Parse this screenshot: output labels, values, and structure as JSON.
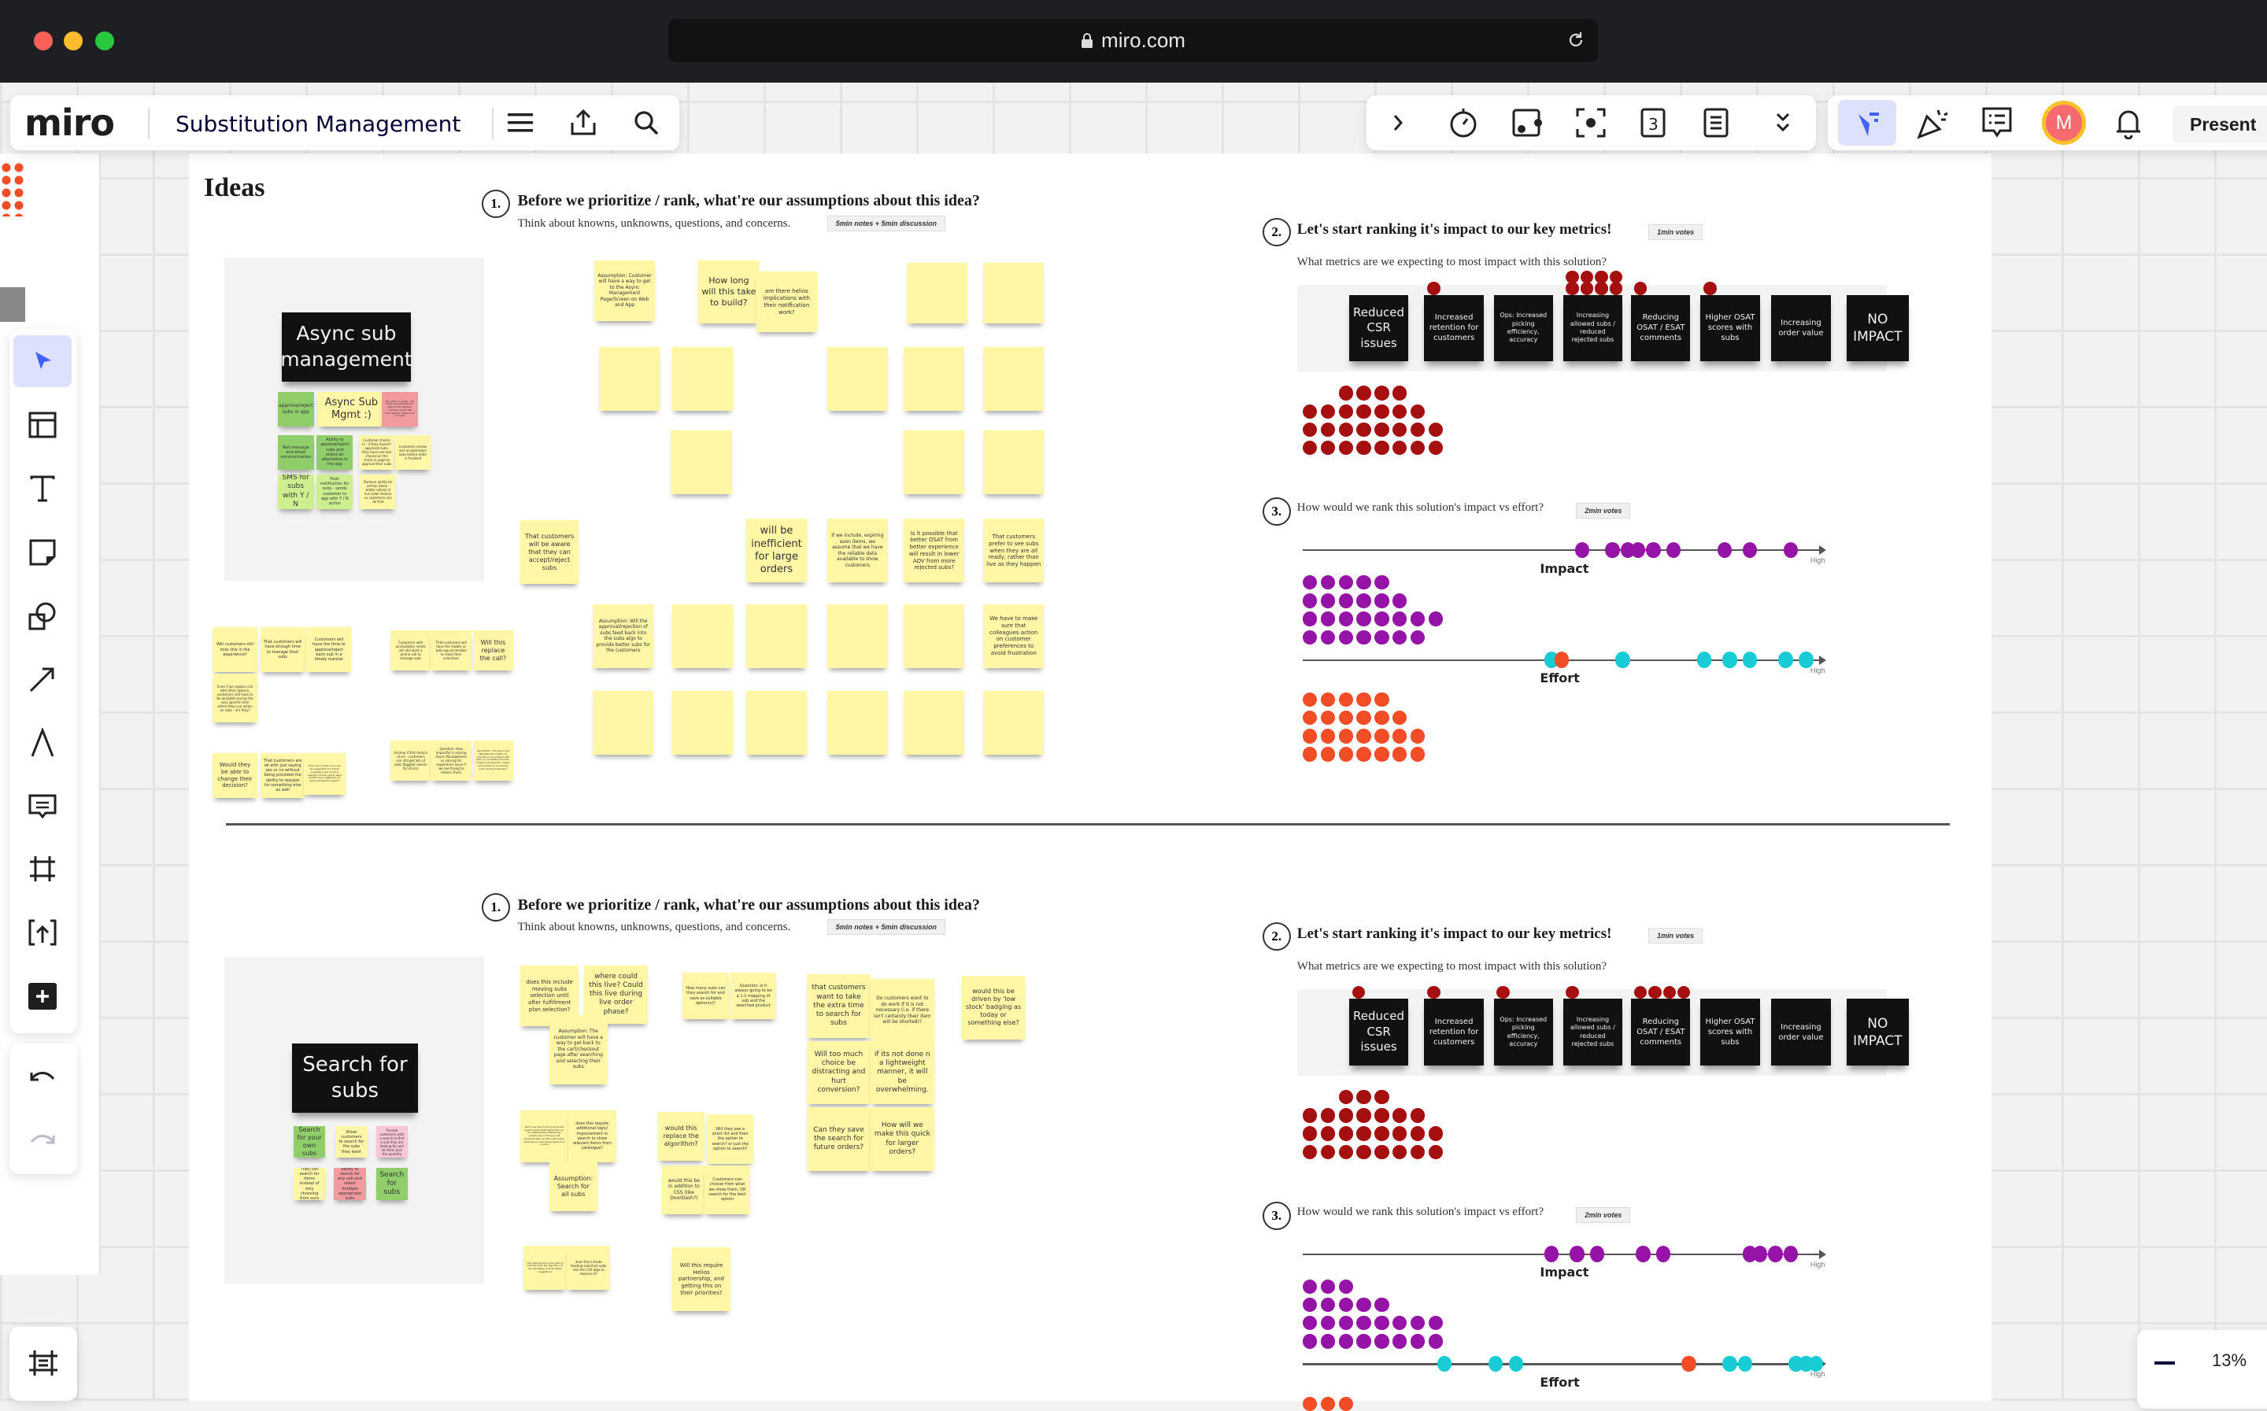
{
  "browser": {
    "url": "miro.com"
  },
  "header": {
    "logo": "miro",
    "board_title": "Substitution Management"
  },
  "toolbar_right": {
    "present_label": "Present",
    "avatar_initial": "M"
  },
  "zoom": {
    "level": "13%"
  },
  "board": {
    "title": "Ideas"
  },
  "colors": {
    "metric_vote": "#a50f0f",
    "impact_vote": "#9613a8",
    "effort_vote": "#19cbd4",
    "effort_vote_alt": "#f24d26",
    "note_yellow": "#fff6a6",
    "note_green": "#8fce6b",
    "note_light_green": "#cdef90",
    "note_pink": "#f19aa0",
    "note_light_pink": "#f8c6d6",
    "accent": "#4262ff"
  },
  "sections": [
    {
      "idea_title": "Async sub management",
      "step1": {
        "number": "1.",
        "title": "Before we prioritize / rank, what're our assumptions about this idea?",
        "subtitle": "Think about knowns, unknowns, questions,  and concerns.",
        "timer": "5min notes + 5min discussion"
      },
      "idea_notes": [
        {
          "text": "approve/reject subs in app",
          "color": "green"
        },
        {
          "text": "Async Sub Mgmt :)",
          "color": "yellow"
        },
        {
          "text": "Allocation in reality - are there any substitutions without the needing customer input? We don't want to make it too complex",
          "color": "pink"
        },
        {
          "text": "Text message and email communication",
          "color": "green"
        },
        {
          "text": "Ability to approve/reject subs and select an alternative in the app",
          "color": "green"
        },
        {
          "text": "Customer checks in - if they haven't approved subs, they have one last chance on the check in page to approve their subs",
          "color": "yellow"
        },
        {
          "text": "customers review and accept/reject subs before order is finalized",
          "color": "yellow"
        },
        {
          "text": "SMS for subs with Y / N",
          "color": "light_green"
        },
        {
          "text": "Push notification for subs - sends customer to app with Y / N action",
          "color": "light_green"
        },
        {
          "text": "Remove ability for ad-hoc items - better rollout of live order feature so customers can do that",
          "color": "yellow"
        }
      ],
      "assumption_notes": [
        {
          "text": "Assumption: Customer will have a way to get to the Async Management Page/Screen on Web and App"
        },
        {
          "text": "How long will this take to build?"
        },
        {
          "text": "are there helios implications with their notification work?"
        },
        {
          "text": ""
        },
        {
          "text": ""
        },
        {
          "text": ""
        },
        {
          "text": ""
        },
        {
          "text": ""
        },
        {
          "text": ""
        },
        {
          "text": ""
        },
        {
          "text": ""
        },
        {
          "text": ""
        },
        {
          "text": ""
        },
        {
          "text": "That customers will be aware that they can accept/reject subs"
        },
        {
          "text": "will be inefficient for large orders"
        },
        {
          "text": "If we include, expiring soon items, we assume that we have the reliable data available to show customers"
        },
        {
          "text": "Is it possible that better OSAT from better experience will result in lower AOV from more rejected subs?"
        },
        {
          "text": "That customers prefer to see subs when they are all ready, rather than live as they happen"
        },
        {
          "text": "Assumption: Will the approval/rejection of subs feed back into the subs algo to provide better subs for the customers"
        },
        {
          "text": ""
        },
        {
          "text": ""
        },
        {
          "text": ""
        },
        {
          "text": ""
        },
        {
          "text": "We have to make sure that colleagues action on customer preferences to avoid frustration"
        },
        {
          "text": ""
        },
        {
          "text": ""
        },
        {
          "text": ""
        },
        {
          "text": ""
        },
        {
          "text": ""
        },
        {
          "text": ""
        },
        {
          "text": "Will customers still miss this in the experience?"
        },
        {
          "text": "That customers will have enough time to manage their subs"
        },
        {
          "text": "Customers will have the time to approve/reject each sub in a timely manner"
        },
        {
          "text": "Even if we replace call with other options, customers still have to be available during the very specific time where they can action on subs - are they?"
        },
        {
          "text": "Would they be able to change their decision?"
        },
        {
          "text": "That customers are ok with just saying yes or no without being provided the ability to request for something else as well"
        },
        {
          "text": "How many times can a sub be suggested? If a picker suggests a sub and it is rejected, do they get to send another sub suggestion for approval/rejection again?"
        },
        {
          "text": "Customers with accessibility needs will still want a phone call to manage subs"
        },
        {
          "text": "That customers will have the mobile or web app accessible to make their selections"
        },
        {
          "text": "Will this replace the call?"
        },
        {
          "text": "Unclear if this reduce churn - customers can still get lots of subs (biggest reason for churn)"
        },
        {
          "text": "Question: How impactful is solving Async Management vs solving for experience issue if we are trying to reduce churn"
        },
        {
          "text": "Assumption: The Async Sub Management might not solve the core problem with subs i.e. unrelated products, limited sub selection, higher priced subs or not having subs causing frustration"
        }
      ],
      "step2": {
        "number": "2.",
        "title": "Let's start ranking it's impact to our key metrics!",
        "timer": "1min votes",
        "subtitle": "What metrics are we expecting to most impact with this solution?"
      },
      "metrics": [
        {
          "label": "Reduced CSR issues",
          "votes": 0
        },
        {
          "label": "Increased retention for customers",
          "votes": 1
        },
        {
          "label": "Ops: Increased picking efficiency, accuracy",
          "votes": 0
        },
        {
          "label": "Increasing allowed subs / reduced rejected subs",
          "votes": 8
        },
        {
          "label": "Reducing OSAT / ESAT comments",
          "votes": 1
        },
        {
          "label": "Higher OSAT scores with subs",
          "votes": 1
        },
        {
          "label": "Increasing order value",
          "votes": 0
        },
        {
          "label": "NO IMPACT",
          "votes": 0
        }
      ],
      "unused_metric_vote_rows": [
        4,
        7,
        8,
        8
      ],
      "step3": {
        "number": "3.",
        "title": "How would we rank this solution's impact vs effort?",
        "timer": "2min votes",
        "impact_label": "Impact",
        "effort_label": "Effort",
        "high_label": "High"
      },
      "impact_votes": [
        54,
        60,
        63,
        65,
        68,
        72,
        82,
        87,
        95
      ],
      "effort_votes": [
        {
          "pos": 48,
          "color": "effort_vote"
        },
        {
          "pos": 50,
          "color": "effort_vote_alt"
        },
        {
          "pos": 62,
          "color": "effort_vote"
        },
        {
          "pos": 78,
          "color": "effort_vote"
        },
        {
          "pos": 83,
          "color": "effort_vote"
        },
        {
          "pos": 87,
          "color": "effort_vote"
        },
        {
          "pos": 94,
          "color": "effort_vote"
        },
        {
          "pos": 98,
          "color": "effort_vote"
        }
      ],
      "unused_impact_vote_rows": [
        5,
        6,
        8,
        7
      ],
      "unused_effort_vote_rows": [
        5,
        6,
        7,
        7
      ]
    },
    {
      "idea_title": "Search for subs",
      "step1": {
        "number": "1.",
        "title": "Before we prioritize / rank, what're our assumptions about this idea?",
        "subtitle": "Think about knowns, unknowns, questions,  and concerns.",
        "timer": "5min notes + 5min discussion"
      },
      "idea_notes": [
        {
          "text": "Search for your own subs",
          "color": "green"
        },
        {
          "text": "Allow customers to search for the subs they want",
          "color": "yellow"
        },
        {
          "text": "Provide customers with a search to find a sub they are looking for and let them pick the quantity",
          "color": "light_pink"
        },
        {
          "text": "They can search for items instead of only choosing from ours",
          "color": "yellow"
        },
        {
          "text": "ability to search for any sub and select multiple appropriate subs",
          "color": "pink"
        },
        {
          "text": "Search for subs",
          "color": "green"
        }
      ],
      "assumption_notes": [
        {
          "text": "does this include moving subs selection until after fulfillment plan selection?"
        },
        {
          "text": "where could this live? Could this live during live order phase?"
        },
        {
          "text": "Assumption: The customer will have a way to get back to the cart/checkout page after searching and selecting their subs"
        },
        {
          "text": "How many subs can they search for and save as suitable option(s)?"
        },
        {
          "text": "Question: Is it always going to be a 1:1 mapping of sub and the searched product"
        },
        {
          "text": "that customers want to take the extra time to search for subs"
        },
        {
          "text": "Do customers want to do work if it is not necessary (i.e. if there isn't certainty their item will be shorted)?"
        },
        {
          "text": "would this be driven by 'low stock' badging as today or something else?"
        },
        {
          "text": "Will  too much choice be distracting and hurt conversion?"
        },
        {
          "text": "if its not done n a lightweight manner, it will be overwhelming."
        },
        {
          "text": "Can they save the search for future orders?"
        },
        {
          "text": "How will we make this quick for larger orders?"
        },
        {
          "text": "Won't we have to fix some of the search issues first before this can be implemented effectively? people rely on the pre-call because they can find subs easier that way by describing where it is in store"
        },
        {
          "text": "does this require additional logic/ improvement in search to show relevant items from catalogue?"
        },
        {
          "text": "Assumption: Search for all subs"
        },
        {
          "text": "would this replace the algorithm?"
        },
        {
          "text": "Will they see a short list and then the option to search? or just the option to search?"
        },
        {
          "text": "would this be in addition to CSS (like DoorDash?)"
        },
        {
          "text": "Customers can choose from what we show them, OR search for the best option"
        },
        {
          "text": "The selected item from Search will help train the algorithm so we ultimately provide better suggestions"
        },
        {
          "text": "does this include feeding searched subs into the CSS algo to improve it?"
        },
        {
          "text": "Will this require Helios partnership, and getting this on their priorities?"
        }
      ],
      "step2": {
        "number": "2.",
        "title": "Let's start ranking it's impact to our key metrics!",
        "timer": "1min votes",
        "subtitle": "What metrics are we expecting to most impact with this solution?"
      },
      "metrics": [
        {
          "label": "Reduced CSR issues",
          "votes": 1
        },
        {
          "label": "Increased retention for customers",
          "votes": 1
        },
        {
          "label": "Ops: Increased picking efficiency, accuracy",
          "votes": 1
        },
        {
          "label": "Increasing allowed subs / reduced rejected subs",
          "votes": 1
        },
        {
          "label": "Reducing OSAT / ESAT comments",
          "votes": 4
        },
        {
          "label": "Higher OSAT scores with subs",
          "votes": 0
        },
        {
          "label": "Increasing order value",
          "votes": 0
        },
        {
          "label": "NO IMPACT",
          "votes": 0
        }
      ],
      "unused_metric_vote_rows": [
        3,
        7,
        8,
        8
      ],
      "step3": {
        "number": "3.",
        "title": "How would we rank this solution's impact vs effort?",
        "timer": "2min votes",
        "impact_label": "Impact",
        "effort_label": "Effort",
        "high_label": "High"
      },
      "impact_votes": [
        48,
        53,
        57,
        66,
        70,
        87,
        89,
        92,
        95
      ],
      "effort_votes": [
        {
          "pos": 27,
          "color": "effort_vote"
        },
        {
          "pos": 37,
          "color": "effort_vote"
        },
        {
          "pos": 41,
          "color": "effort_vote"
        },
        {
          "pos": 75,
          "color": "effort_vote_alt"
        },
        {
          "pos": 83,
          "color": "effort_vote"
        },
        {
          "pos": 86,
          "color": "effort_vote"
        },
        {
          "pos": 96,
          "color": "effort_vote"
        },
        {
          "pos": 98,
          "color": "effort_vote"
        },
        {
          "pos": 100,
          "color": "effort_vote"
        }
      ],
      "unused_impact_vote_rows": [
        3,
        5,
        8,
        8
      ],
      "unused_effort_vote_rows": [
        3
      ]
    }
  ]
}
